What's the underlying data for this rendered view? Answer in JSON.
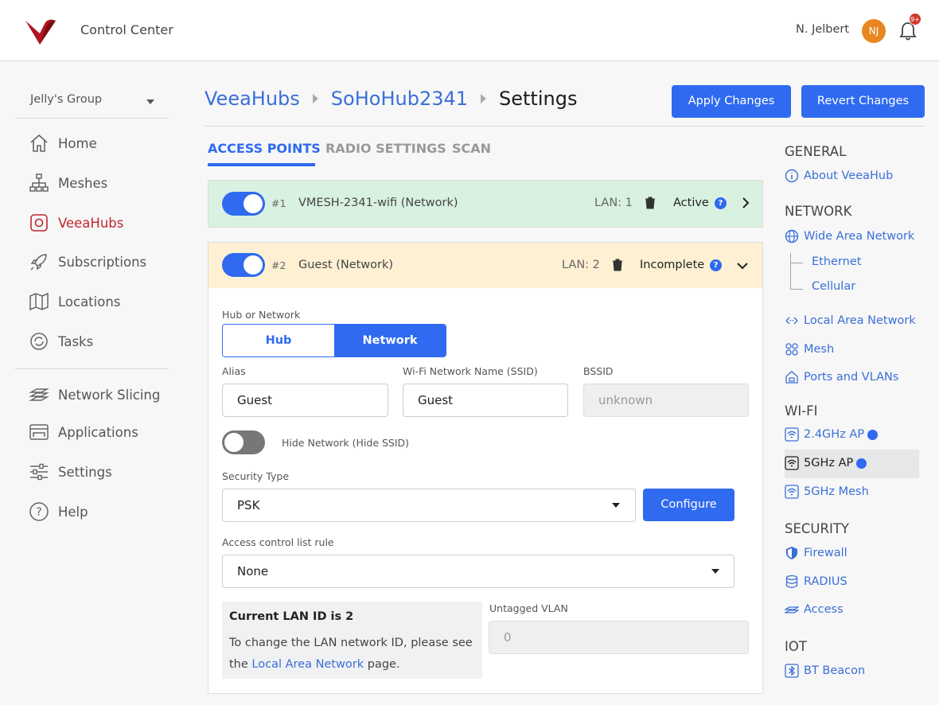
{
  "header": {
    "title": "Control Center",
    "user_name": "N. Jelbert",
    "avatar_initials": "NJ",
    "notification_badge": "9+"
  },
  "sidebar": {
    "group": "Jelly's Group",
    "items": [
      {
        "label": "Home",
        "icon": "home-icon"
      },
      {
        "label": "Meshes",
        "icon": "meshes-icon"
      },
      {
        "label": "VeeaHubs",
        "icon": "veeahubs-icon",
        "active": true
      },
      {
        "label": "Subscriptions",
        "icon": "rocket-icon"
      },
      {
        "label": "Locations",
        "icon": "map-icon"
      },
      {
        "label": "Tasks",
        "icon": "tasks-icon"
      },
      {
        "label": "Network Slicing",
        "icon": "layers-icon"
      },
      {
        "label": "Applications",
        "icon": "applications-icon"
      },
      {
        "label": "Settings",
        "icon": "sliders-icon"
      },
      {
        "label": "Help",
        "icon": "help-icon"
      }
    ]
  },
  "breadcrumb": {
    "items": [
      "VeeaHubs",
      "SoHoHub2341"
    ],
    "current": "Settings"
  },
  "actions": {
    "apply": "Apply Changes",
    "revert": "Revert Changes"
  },
  "tabs": [
    "ACCESS POINTS",
    "RADIO SETTINGS",
    "SCAN"
  ],
  "access_points": [
    {
      "num": "#1",
      "name": "VMESH-2341-wifi (Network)",
      "lan": "LAN: 1",
      "status": "Active",
      "enabled": true
    },
    {
      "num": "#2",
      "name": "Guest (Network)",
      "lan": "LAN: 2",
      "status": "Incomplete",
      "enabled": true
    }
  ],
  "form": {
    "hub_or_network_label": "Hub or Network",
    "hub_option": "Hub",
    "network_option": "Network",
    "alias_label": "Alias",
    "alias_value": "Guest",
    "ssid_label": "Wi-Fi Network Name (SSID)",
    "ssid_value": "Guest",
    "bssid_label": "BSSID",
    "bssid_placeholder": "unknown",
    "hide_network_label": "Hide Network (Hide SSID)",
    "security_label": "Security Type",
    "security_value": "PSK",
    "configure": "Configure",
    "acl_label": "Access control list rule",
    "acl_value": "None",
    "lan_title": "Current LAN ID is 2",
    "lan_text_before": "To change the LAN network ID, please see the",
    "lan_link": "Local Area Network",
    "lan_text_after": "page.",
    "untagged_label": "Untagged VLAN",
    "untagged_placeholder": "0"
  },
  "right_nav": {
    "general": {
      "title": "GENERAL",
      "about": "About VeeaHub"
    },
    "network": {
      "title": "NETWORK",
      "wan": "Wide Area Network",
      "ethernet": "Ethernet",
      "cellular": "Cellular",
      "lan": "Local Area Network",
      "mesh": "Mesh",
      "ports": "Ports and VLANs"
    },
    "wifi": {
      "title": "WI-FI",
      "ap24": "2.4GHz AP",
      "ap5": "5GHz AP",
      "mesh5": "5GHz Mesh"
    },
    "security": {
      "title": "SECURITY",
      "firewall": "Firewall",
      "radius": "RADIUS",
      "access": "Access"
    },
    "iot": {
      "title": "IOT",
      "beacon": "BT Beacon"
    }
  },
  "colors": {
    "primary": "#2f6af0",
    "brand_red": "#c0262d",
    "active_row": "#d9f1e0",
    "incomplete_row": "#fdf0d3",
    "avatar": "#e8861f"
  }
}
